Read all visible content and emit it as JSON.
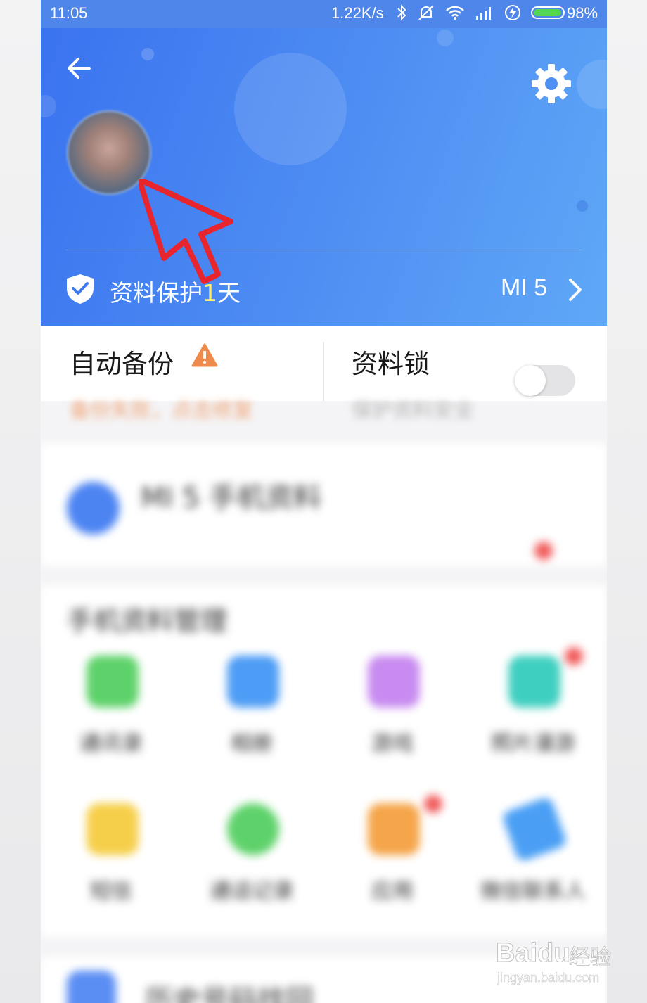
{
  "status_bar": {
    "time": "11:05",
    "net_speed": "1.22K/s",
    "battery": "98%",
    "battery_level": 0.98,
    "icons": [
      "bluetooth-icon",
      "mute-icon",
      "wifi-icon",
      "signal-icon",
      "charging-icon",
      "battery-icon"
    ]
  },
  "header": {
    "back_icon": "back-arrow-icon",
    "settings_icon": "gear-icon",
    "username": "",
    "protection_prefix": "资料保护",
    "protection_days": "1",
    "protection_suffix": "天",
    "device_name": "MI 5",
    "colors": {
      "gradient_start": "#3a73ef",
      "gradient_end": "#5fa8f7",
      "days_highlight": "#fff26b"
    }
  },
  "backup_card": {
    "auto_backup_label": "自动备份",
    "auto_backup_warning_icon": "warning-icon",
    "auto_backup_sub": "备份失败，点击修复",
    "data_lock_label": "资料锁",
    "data_lock_sub": "保护资料安全",
    "data_lock_enabled": false
  },
  "promo": {
    "title": "MI 5 手机资料",
    "subtitle": ""
  },
  "section": {
    "title": "手机资料管理",
    "items": [
      {
        "label": "通讯录",
        "color": "#5ed26a",
        "badge": false
      },
      {
        "label": "相册",
        "color": "#4d9cf5",
        "badge": false
      },
      {
        "label": "游戏",
        "color": "#c88bf0",
        "badge": false
      },
      {
        "label": "照片漫游",
        "color": "#3fcfc0",
        "badge": true
      },
      {
        "label": "短信",
        "color": "#f6cf4a",
        "badge": false
      },
      {
        "label": "通话记录",
        "color": "#5ed26a",
        "badge": false
      },
      {
        "label": "应用",
        "color": "#f5a54a",
        "badge": true
      },
      {
        "label": "微信联系人",
        "color": "#4a9ff5",
        "badge": false
      }
    ]
  },
  "history": {
    "label": "历史号码找回"
  },
  "watermark": {
    "brand": "Baidu",
    "brand_cn": "经验",
    "url": "jingyan.baidu.com"
  }
}
